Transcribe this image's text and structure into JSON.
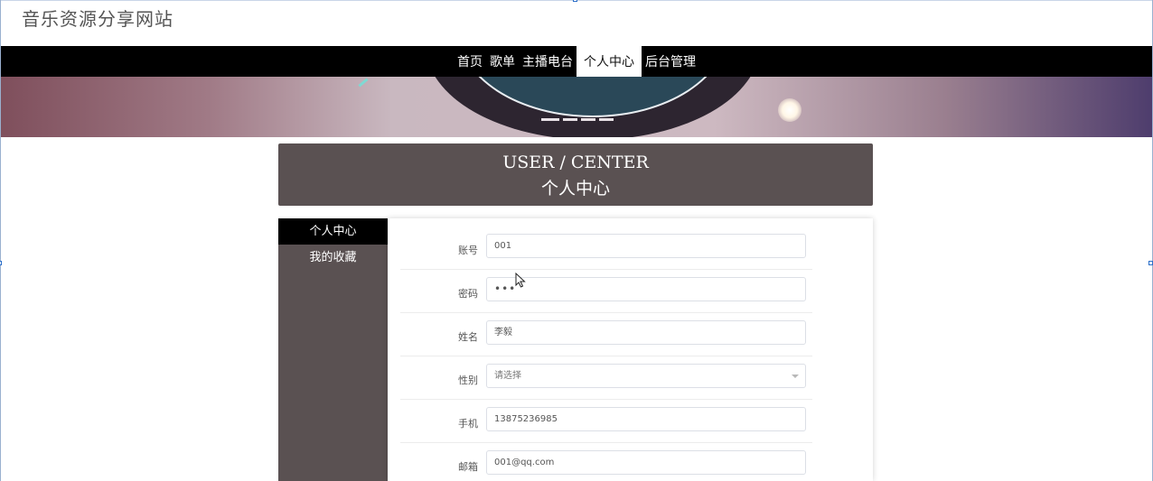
{
  "site": {
    "title": "音乐资源分享网站"
  },
  "nav": {
    "items": [
      {
        "label": "首页"
      },
      {
        "label": "歌单"
      },
      {
        "label": "主播电台"
      },
      {
        "label": "个人中心"
      },
      {
        "label": "后台管理"
      }
    ],
    "active_index": 3
  },
  "center_header": {
    "title_en": "USER / CENTER",
    "title_cn": "个人中心"
  },
  "sidebar": {
    "items": [
      {
        "label": "个人中心"
      },
      {
        "label": "我的收藏"
      }
    ],
    "active_index": 0
  },
  "form": {
    "account": {
      "label": "账号",
      "value": "001"
    },
    "password": {
      "label": "密码",
      "value": "•••"
    },
    "name": {
      "label": "姓名",
      "value": "李毅"
    },
    "gender": {
      "label": "性别",
      "placeholder": "请选择"
    },
    "phone": {
      "label": "手机",
      "value": "13875236985"
    },
    "email": {
      "label": "邮箱",
      "value": "001@qq.com"
    }
  },
  "colors": {
    "navbar": "#000000",
    "panel_header": "#5a5152",
    "sidebar": "#5a5152",
    "active_sidebar": "#000000"
  },
  "icons": {
    "select": "chevron-down-icon",
    "cursor": "mouse-pointer-icon"
  }
}
